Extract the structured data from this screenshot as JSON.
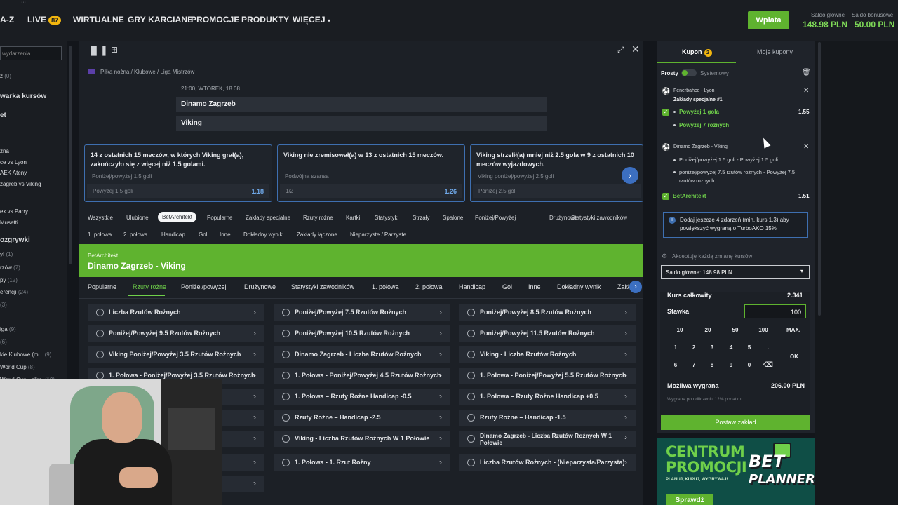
{
  "topnav": {
    "items": [
      "A-Z",
      "LIVE",
      "WIRTUALNE",
      "GRY KARCIANE",
      "PROMOCJE",
      "PRODUKTY",
      "WIĘCEJ"
    ],
    "live_count": "87",
    "deposit": "Wpłata",
    "saldo_glowne_label": "Saldo główne",
    "saldo_glowne": "148.98 PLN",
    "saldo_bonus_label": "Saldo bonusowe",
    "saldo_bonus": "50.00 PLN"
  },
  "sidebar": {
    "search_placeholder": "wydarzenia...",
    "items": [
      {
        "label": "z",
        "count": "(0)"
      },
      {
        "label": "warka kursów",
        "count": ""
      },
      {
        "label": "et",
        "count": ""
      },
      {
        "label": "żna",
        "count": ""
      },
      {
        "label": "ce vs Lyon",
        "count": ""
      },
      {
        "label": "AEK Ateny",
        "count": ""
      },
      {
        "label": "zagreb vs Viking",
        "count": ""
      },
      {
        "label": "ek vs Parry",
        "count": ""
      },
      {
        "label": "Musetti",
        "count": ""
      },
      {
        "label": "ozgrywki",
        "count": ""
      },
      {
        "label": "y!",
        "count": "(1)"
      },
      {
        "label": "rzów",
        "count": "(7)"
      },
      {
        "label": "py",
        "count": "(12)"
      },
      {
        "label": "erencji",
        "count": "(24)"
      },
      {
        "label": "",
        "count": "(3)"
      },
      {
        "label": "iga",
        "count": "(9)"
      },
      {
        "label": "",
        "count": "(6)"
      },
      {
        "label": "kie Klubowe (m...",
        "count": "(9)"
      },
      {
        "label": "World Cup",
        "count": "(8)"
      },
      {
        "label": "World Cup - elim.",
        "count": "(19)"
      }
    ]
  },
  "event": {
    "breadcrumb": "Piłka nożna / Klubowe / Liga Mistrzów",
    "time": "21:00, WTOREK, 18.08",
    "home": "Dinamo Zagrzeb",
    "away": "Viking"
  },
  "stats": [
    {
      "text": "14 z ostatnich 15 meczów, w których Viking grał(a), zakończyło się z więcej niż 1.5 golami.",
      "sub": "Poniżej/powyżej 1.5 goli",
      "pick": "Powyżej 1.5 goli",
      "odd": "1.18"
    },
    {
      "text": "Viking nie zremisował(a) w 13 z ostatnich 15 meczów.",
      "sub": "Podwójna szansa",
      "pick": "1/2",
      "odd": "1.26"
    },
    {
      "text": "Viking strzelił(a) mniej niż 2.5 gola w 9 z ostatnich 10 meczów wyjazdowych.",
      "sub": "Viking poniżej/powyżej 2.5 goli",
      "pick": "Poniżej 2.5 goli",
      "odd": ""
    }
  ],
  "filters_row1": [
    "Wszystkie",
    "Ulubione",
    "BetArchitekt",
    "Popularne",
    "Zakłady specjalne",
    "Rzuty rożne",
    "Kartki",
    "Statystyki",
    "Strzały",
    "Spalone",
    "Poniżej/Powyżej",
    "Drużynowe",
    "Statystyki zawodników"
  ],
  "filters_row2": [
    "1. połowa",
    "2. połowa",
    "Handicap",
    "Gol",
    "Inne",
    "Dokładny wynik",
    "Zakłady łączone",
    "Nieparzyste / Parzyste"
  ],
  "betarchitekt": {
    "label": "BetArchitekt",
    "title": "Dinamo Zagrzeb - Viking"
  },
  "subtabs": [
    "Popularne",
    "Rzuty rożne",
    "Poniżej/powyżej",
    "Drużynowe",
    "Statystyki zawodników",
    "1. połowa",
    "2. połowa",
    "Handicap",
    "Gol",
    "Inne",
    "Dokładny wynik",
    "Zakł"
  ],
  "markets": [
    "Liczba Rzutów Rożnych",
    "Poniżej/Powyżej 7.5 Rzutów Rożnych",
    "Poniżej/Powyżej 8.5 Rzutów Rożnych",
    "Poniżej/Powyżej 9.5 Rzutów Rożnych",
    "Poniżej/Powyżej 10.5 Rzutów Rożnych",
    "Poniżej/Powyżej 11.5 Rzutów Rożnych",
    "Viking Poniżej/Powyżej 3.5 Rzutów Rożnych",
    "Dinamo Zagrzeb - Liczba Rzutów Rożnych",
    "Viking - Liczba Rzutów Rożnych",
    "1. Połowa - Poniżej/Powyżej 3.5 Rzutów Rożnych",
    "1. Połowa - Poniżej/Powyżej 4.5 Rzutów Rożnych",
    "1. Połowa - Poniżej/Powyżej 5.5 Rzutów Rożnych",
    "",
    "1. Połowa – Rzuty Rożne Handicap -0.5",
    "1. Połowa – Rzuty Rożne Handicap +0.5",
    "",
    "Rzuty Rożne – Handicap -2.5",
    "Rzuty Rożne – Handicap -1.5",
    "",
    "Viking - Liczba Rzutów Rożnych W 1 Połowie",
    "Dinamo Zagrzeb - Liczba Rzutów Rożnych W 1 Połowie",
    "",
    "1. Połowa - 1. Rzut Rożny",
    "Liczba Rzutów Rożnych - (Nieparzysta/Parzysta)",
    ""
  ],
  "coupon": {
    "tab_active": "Kupon",
    "tab_count": "2",
    "tab_other": "Moje kupony",
    "simple": "Prosty",
    "system": "Systemowy",
    "bet1_match": "Fenerbahce - Lyon",
    "bet1_market": "Zakłady specjalne #1",
    "bet1_sel1": "Powyżej 1 gola",
    "bet1_odd": "1.55",
    "bet1_sel2": "Powyżej 7 rożnych",
    "bet2_match": "Dinamo Zagrzeb - Viking",
    "bet2_sel1": "Poniżej/powyżej 1.5 goli - Powyżej 1.5 goli",
    "bet2_sel2": "poniżej/powyżej 7.5 rzutów rożnych - Powyżej 7.5 rzutów rożnych",
    "bet2_source": "BetArchitekt",
    "bet2_odd": "1.51",
    "info": "Dodaj jeszcze 4 zdarzeń (min. kurs 1.3) aby powiększyć wygraną o TurboAKO 15%",
    "accept": "Akceptuję każdą zmianę kursów",
    "balance_select": "Saldo główne: 148.98 PLN",
    "total_odds_label": "Kurs całkowity",
    "total_odds": "2.341",
    "stake_label": "Stawka",
    "stake": "100",
    "quick": [
      "10",
      "20",
      "50",
      "100",
      "MAX."
    ],
    "keys1": [
      "1",
      "2",
      "3",
      "4",
      "5",
      "."
    ],
    "keys2": [
      "6",
      "7",
      "8",
      "9",
      "0",
      "⌫"
    ],
    "ok": "OK",
    "win_label": "Możliwa wygrana",
    "win": "206.00 PLN",
    "tax_note": "Wygrana po odliczeniu 12% podatku",
    "post": "Postaw zakład"
  },
  "promo": {
    "title1": "CENTRUM",
    "title2": "PROMOCJI",
    "sub": "PLANUJ, KUPUJ, WYGRYWAJ!",
    "button": "Sprawdź",
    "logo1": "BET",
    "logo2": "PLANNER"
  },
  "colors": {
    "accent_green": "#5fb32f",
    "accent_blue": "#3e6fb0",
    "bg": "#13161b"
  }
}
